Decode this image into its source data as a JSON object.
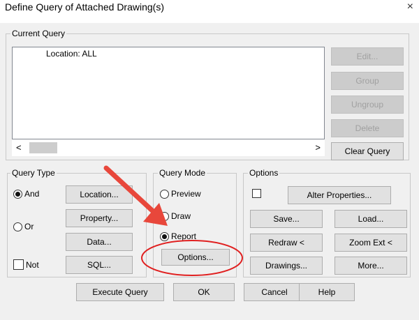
{
  "window": {
    "title": "Define Query of Attached Drawing(s)",
    "close_glyph": "×"
  },
  "current_query": {
    "label": "Current Query",
    "lines": [
      "Location: ALL"
    ],
    "scroll_left_glyph": "<",
    "scroll_right_glyph": ">"
  },
  "side_buttons": {
    "edit": "Edit...",
    "group": "Group",
    "ungroup": "Ungroup",
    "delete": "Delete",
    "clear_query": "Clear Query"
  },
  "query_type": {
    "label": "Query Type",
    "and": "And",
    "or": "Or",
    "not": "Not",
    "location_btn": "Location...",
    "property_btn": "Property...",
    "data_btn": "Data...",
    "sql_btn": "SQL..."
  },
  "query_mode": {
    "label": "Query Mode",
    "preview": "Preview",
    "draw": "Draw",
    "report": "Report",
    "options_btn": "Options..."
  },
  "options": {
    "label": "Options",
    "alter_properties": "Alter Properties...",
    "save": "Save...",
    "load": "Load...",
    "redraw": "Redraw <",
    "zoom_ext": "Zoom Ext <",
    "drawings": "Drawings...",
    "more": "More..."
  },
  "footer": {
    "execute": "Execute Query",
    "ok": "OK",
    "cancel": "Cancel",
    "help": "Help"
  },
  "annotation": {
    "arrow_color": "#e8473b",
    "circle_color": "#e02020"
  }
}
